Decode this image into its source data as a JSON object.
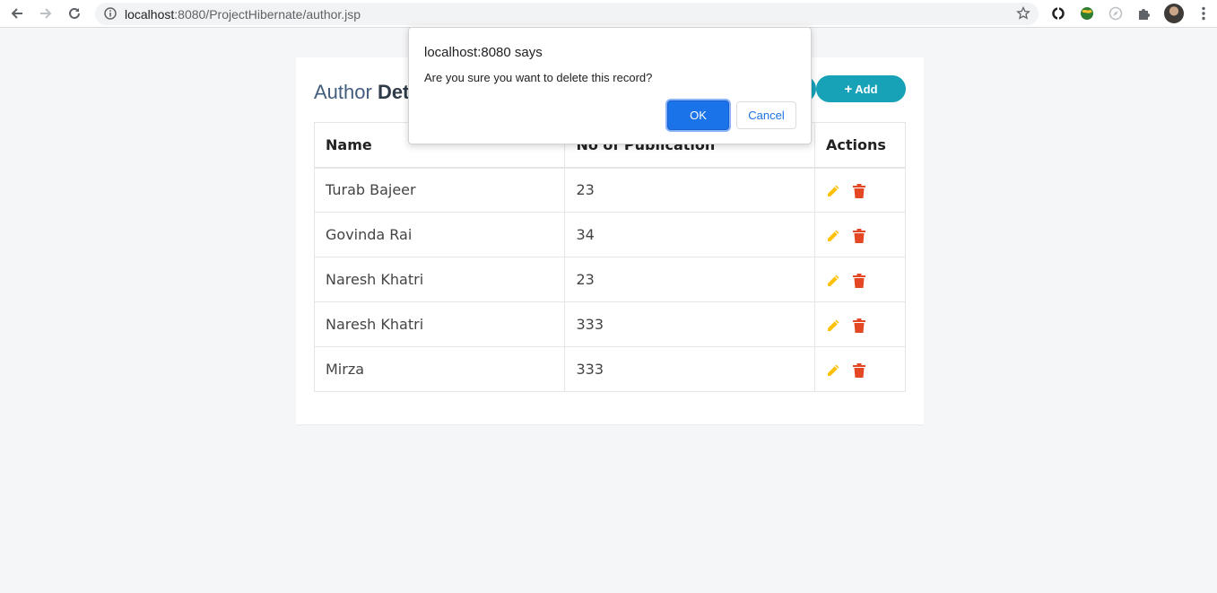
{
  "browser": {
    "url_host": "localhost",
    "url_rest": ":8080/ProjectHibernate/author.jsp"
  },
  "page": {
    "title_light": "Author ",
    "title_bold": "Details",
    "add_label": "Add",
    "columns": [
      "Name",
      "No of Publication",
      "Actions"
    ],
    "rows": [
      {
        "name": "Turab Bajeer",
        "publications": "23"
      },
      {
        "name": "Govinda Rai",
        "publications": "34"
      },
      {
        "name": "Naresh Khatri",
        "publications": "23"
      },
      {
        "name": "Naresh Khatri",
        "publications": "333"
      },
      {
        "name": "Mirza",
        "publications": "333"
      }
    ],
    "colors": {
      "edit": "#ffc107",
      "delete": "#e34724",
      "accent": "#17a2b8"
    }
  },
  "dialog": {
    "title": "localhost:8080 says",
    "message": "Are you sure you want to delete this record?",
    "ok_label": "OK",
    "cancel_label": "Cancel"
  }
}
